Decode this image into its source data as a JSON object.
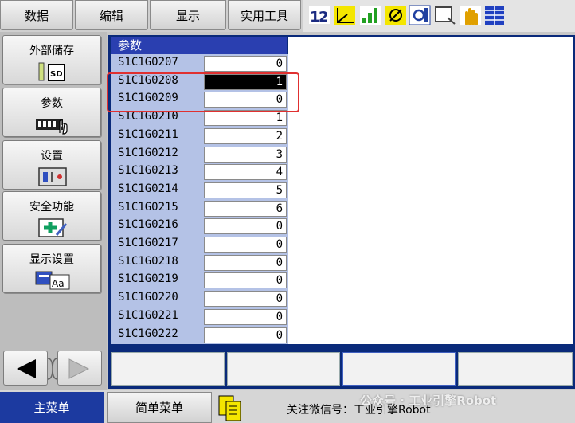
{
  "menu": {
    "items": [
      {
        "label": "数据"
      },
      {
        "label": "编辑"
      },
      {
        "label": "显示"
      },
      {
        "label": "实用工具"
      }
    ]
  },
  "status_icons": [
    "mode-12-icon",
    "coordinate-icon",
    "speed-icon",
    "robot-icon",
    "tool-icon",
    "screen-icon",
    "hand-icon",
    "grid-icon"
  ],
  "sidebar": {
    "items": [
      {
        "label": "外部储存"
      },
      {
        "label": "参数"
      },
      {
        "label": "设置"
      },
      {
        "label": "安全功能"
      },
      {
        "label": "显示设置"
      }
    ]
  },
  "params": {
    "title": "参数",
    "rows": [
      {
        "name": "S1C1G0207",
        "value": "0"
      },
      {
        "name": "S1C1G0208",
        "value": "1"
      },
      {
        "name": "S1C1G0209",
        "value": "0"
      },
      {
        "name": "S1C1G0210",
        "value": "1"
      },
      {
        "name": "S1C1G0211",
        "value": "2"
      },
      {
        "name": "S1C1G0212",
        "value": "3"
      },
      {
        "name": "S1C1G0213",
        "value": "4"
      },
      {
        "name": "S1C1G0214",
        "value": "5"
      },
      {
        "name": "S1C1G0215",
        "value": "6"
      },
      {
        "name": "S1C1G0216",
        "value": "0"
      },
      {
        "name": "S1C1G0217",
        "value": "0"
      },
      {
        "name": "S1C1G0218",
        "value": "0"
      },
      {
        "name": "S1C1G0219",
        "value": "0"
      },
      {
        "name": "S1C1G0220",
        "value": "0"
      },
      {
        "name": "S1C1G0221",
        "value": "0"
      },
      {
        "name": "S1C1G0222",
        "value": "0"
      }
    ]
  },
  "bottom": {
    "main_menu": "主菜单",
    "simple_menu": "简单菜单",
    "message": "关注微信号：工业引擎Robot",
    "watermark": "公众号 · 工业引擎Robot"
  },
  "colors": {
    "accent": "#1c3aa0",
    "highlight": "#e03030",
    "list_bg": "#b4c2e6"
  }
}
